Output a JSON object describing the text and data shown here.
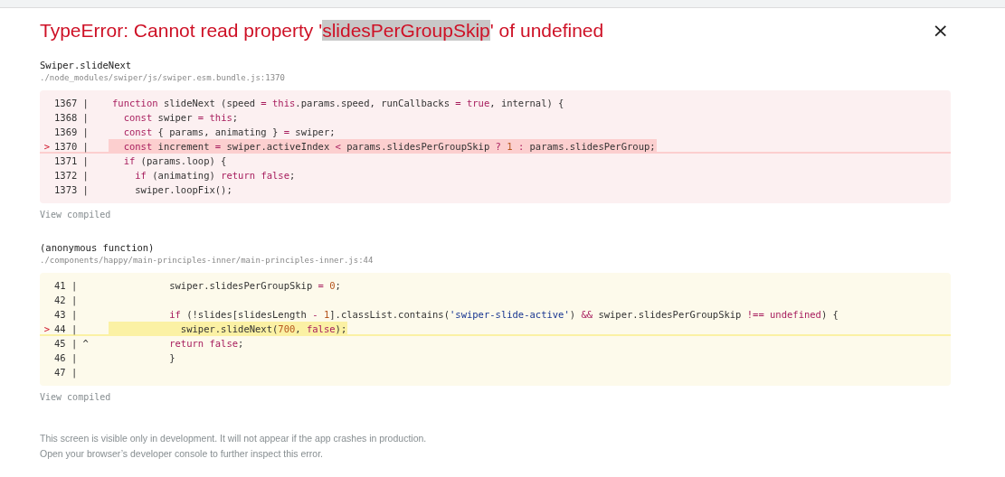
{
  "title": [
    {
      "text": "TypeError: Cannot read property '",
      "highlighted": false
    },
    {
      "text": "slidesPerGroupSkip",
      "highlighted": true
    },
    {
      "text": "' of undefined",
      "highlighted": false
    }
  ],
  "close": "×",
  "frames": [
    {
      "kind": "error",
      "function": "Swiper.slideNext",
      "path": "./node_modules/swiper/js/swiper.esm.bundle.js:1370",
      "link": "View compiled",
      "lines": [
        {
          "gutter": "1367 |",
          "highlighted": false,
          "tokens": [
            {
              "kind": "keyword",
              "text": "function"
            },
            {
              "kind": "plain",
              "text": " slideNext (speed"
            },
            {
              "kind": "operator",
              "text": " = "
            },
            {
              "kind": "keyword",
              "text": "this"
            },
            {
              "kind": "plain",
              "text": ".params.speed, runCallbacks"
            },
            {
              "kind": "operator",
              "text": " = "
            },
            {
              "kind": "keyword",
              "text": "true"
            },
            {
              "kind": "plain",
              "text": ", internal) {"
            }
          ]
        },
        {
          "gutter": "1368 |",
          "highlighted": false,
          "tokens": [
            {
              "kind": "keyword",
              "text": "  const"
            },
            {
              "kind": "plain",
              "text": " swiper"
            },
            {
              "kind": "operator",
              "text": " = "
            },
            {
              "kind": "keyword",
              "text": "this"
            },
            {
              "kind": "plain",
              "text": ";"
            }
          ]
        },
        {
          "gutter": "1369 |",
          "highlighted": false,
          "tokens": [
            {
              "kind": "keyword",
              "text": "  const"
            },
            {
              "kind": "plain",
              "text": " { params, animating }"
            },
            {
              "kind": "operator",
              "text": " = "
            },
            {
              "kind": "plain",
              "text": "swiper;"
            }
          ]
        },
        {
          "pointer": ">",
          "gutter": "1370 |",
          "highlighted": true,
          "tokens": [
            {
              "kind": "keyword",
              "text": "  const"
            },
            {
              "kind": "plain",
              "text": " increment"
            },
            {
              "kind": "operator",
              "text": " = "
            },
            {
              "kind": "plain",
              "text": "swiper.activeIndex"
            },
            {
              "kind": "operator",
              "text": " < "
            },
            {
              "kind": "plain",
              "text": "params.slidesPerGroupSkip"
            },
            {
              "kind": "operator",
              "text": " ? "
            },
            {
              "kind": "number",
              "text": "1"
            },
            {
              "kind": "operator",
              "text": " : "
            },
            {
              "kind": "plain",
              "text": "params.slidesPerGroup;"
            }
          ]
        },
        {
          "gutter": "1371 |",
          "highlighted": false,
          "tokens": [
            {
              "kind": "keyword",
              "text": "  if"
            },
            {
              "kind": "plain",
              "text": " (params.loop) {"
            }
          ]
        },
        {
          "gutter": "1372 |",
          "highlighted": false,
          "tokens": [
            {
              "kind": "keyword",
              "text": "    if"
            },
            {
              "kind": "plain",
              "text": " (animating) "
            },
            {
              "kind": "keyword",
              "text": "return false"
            },
            {
              "kind": "plain",
              "text": ";"
            }
          ]
        },
        {
          "gutter": "1373 |",
          "highlighted": false,
          "tokens": [
            {
              "kind": "plain",
              "text": "    swiper.loopFix();"
            }
          ]
        }
      ]
    },
    {
      "kind": "context",
      "function": "(anonymous function)",
      "path": "./components/happy/main-principles-inner/main-principles-inner.js:44",
      "link": "View compiled",
      "lines": [
        {
          "gutter": "41 |",
          "highlighted": false,
          "tokens": [
            {
              "kind": "plain",
              "text": "          swiper.slidesPerGroupSkip"
            },
            {
              "kind": "operator",
              "text": " = "
            },
            {
              "kind": "number",
              "text": "0"
            },
            {
              "kind": "plain",
              "text": ";"
            }
          ]
        },
        {
          "gutter": "42 |",
          "highlighted": false
        },
        {
          "gutter": "43 |",
          "highlighted": false,
          "tokens": [
            {
              "kind": "keyword",
              "text": "          if"
            },
            {
              "kind": "plain",
              "text": " (!slides[slidesLength"
            },
            {
              "kind": "operator",
              "text": " - "
            },
            {
              "kind": "number",
              "text": "1"
            },
            {
              "kind": "plain",
              "text": "].classList.contains("
            },
            {
              "kind": "string",
              "text": "'swiper-slide-active'"
            },
            {
              "kind": "plain",
              "text": ")"
            },
            {
              "kind": "operator",
              "text": " && "
            },
            {
              "kind": "plain",
              "text": "swiper.slidesPerGroupSkip"
            },
            {
              "kind": "operator",
              "text": " !== "
            },
            {
              "kind": "keyword",
              "text": "undefined"
            },
            {
              "kind": "plain",
              "text": ") {"
            }
          ]
        },
        {
          "pointer": ">",
          "gutter": "44 |",
          "highlighted": true,
          "tokens": [
            {
              "kind": "plain",
              "text": "            swiper.slideNext("
            },
            {
              "kind": "number",
              "text": "700"
            },
            {
              "kind": "plain",
              "text": ", "
            },
            {
              "kind": "keyword",
              "text": "false"
            },
            {
              "kind": "plain",
              "text": ");"
            }
          ]
        },
        {
          "gutter": "45 | ^",
          "highlighted": false,
          "tokens": [
            {
              "kind": "keyword",
              "text": "          return false"
            },
            {
              "kind": "plain",
              "text": ";"
            }
          ]
        },
        {
          "gutter": "46 |",
          "highlighted": false,
          "tokens": [
            {
              "kind": "plain",
              "text": "          }"
            }
          ]
        },
        {
          "gutter": "47 |",
          "highlighted": false
        }
      ]
    }
  ],
  "footer": [
    "This screen is visible only in development. It will not appear if the app crashes in production.",
    "Open your browser’s developer console to further inspect this error."
  ]
}
